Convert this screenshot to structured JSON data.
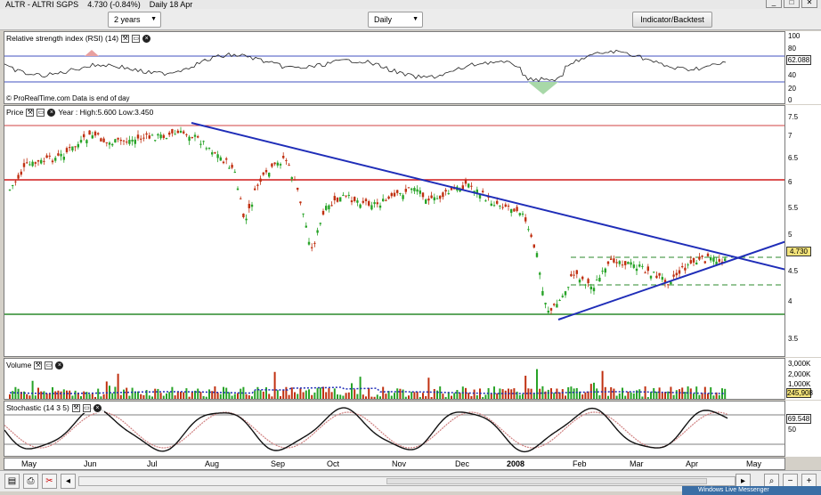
{
  "window": {
    "title": "ALTR - ALTRI SGPS",
    "price_info": "4.730 (-0.84%)",
    "period_info": "Daily 18 Apr",
    "buttons": [
      "_",
      "□",
      "✕"
    ]
  },
  "toolbar": {
    "range_value": "2 years",
    "interval_value": "Daily",
    "indicator_label": "Indicator/Backtest"
  },
  "rsi": {
    "title": "Relative strength index (RSI) (14)",
    "footer": "© ProRealTime.com  Data is end of day",
    "value_label": "62.088",
    "ticks": [
      "100",
      "80",
      "60",
      "40",
      "20",
      "0"
    ]
  },
  "price": {
    "title": "Price",
    "info": "Year : High:5.600 Low:3.450",
    "value_label": "4.730",
    "ticks": [
      "7.5",
      "7",
      "6.5",
      "6",
      "5.5",
      "5",
      "4.5",
      "4",
      "3.5"
    ]
  },
  "volume": {
    "title": "Volume",
    "value_label": "245,908",
    "ticks": [
      "3,000K",
      "2,000K",
      "1,000K"
    ]
  },
  "stochastic": {
    "title": "Stochastic (14 3 5)",
    "value_label": "69.548",
    "ticks": [
      "50"
    ]
  },
  "xaxis": {
    "labels": [
      "May",
      "Jun",
      "Jul",
      "Aug",
      "Sep",
      "Oct",
      "Nov",
      "Dec",
      "2008",
      "Feb",
      "Mar",
      "Apr",
      "May"
    ]
  },
  "taskbar": {
    "text": "Windows Live Messenger"
  },
  "colors": {
    "up": "#27a327",
    "down": "#c03010",
    "trend": "#1f2db8",
    "support": "#2b8a2b",
    "resistance": "#d01818"
  }
}
